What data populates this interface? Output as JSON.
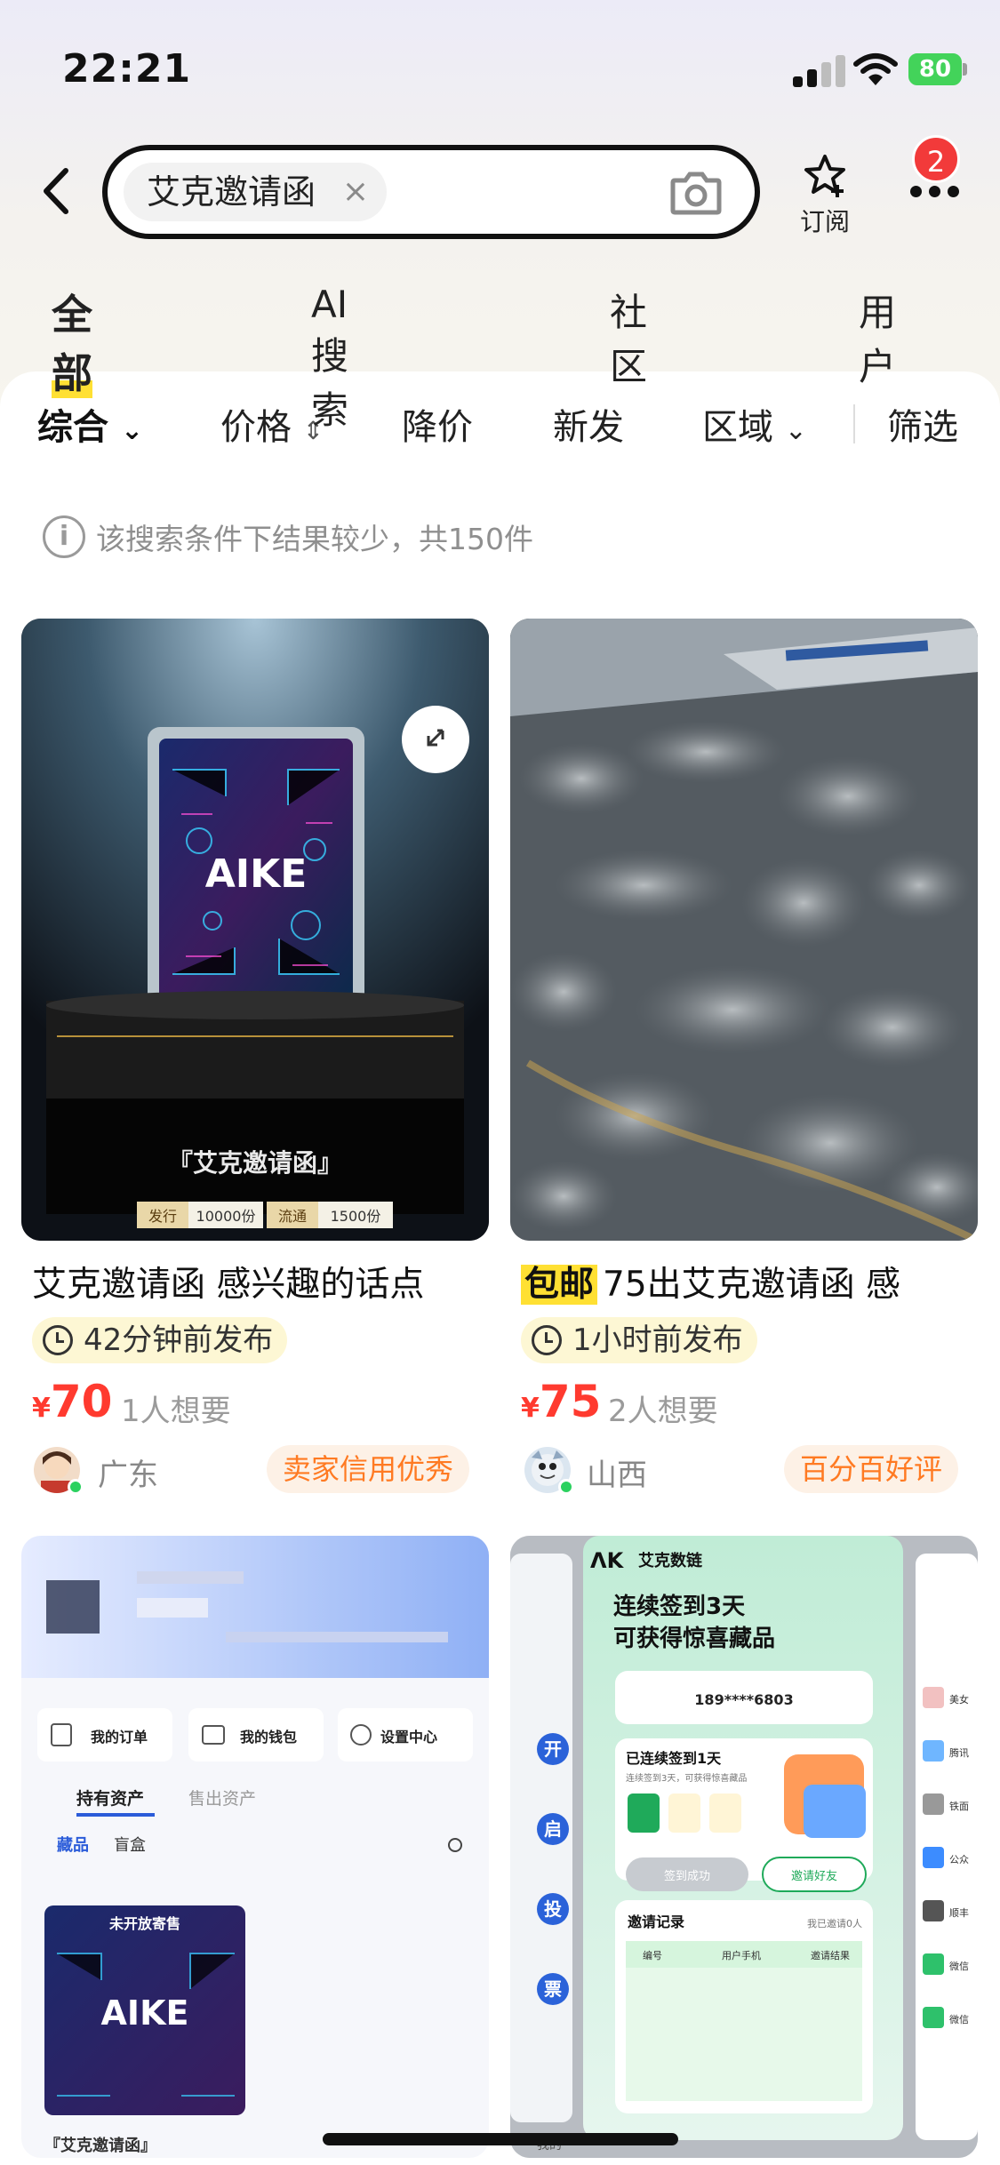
{
  "status_bar": {
    "time": "22:21",
    "battery": "80"
  },
  "search": {
    "query": "艾克邀请函",
    "clear_symbol": "×"
  },
  "header": {
    "subscribe_label": "订阅",
    "notification_count": "2"
  },
  "tabs": [
    {
      "label": "全部",
      "active": true
    },
    {
      "label": "AI 搜索",
      "active": false
    },
    {
      "label": "社区",
      "active": false
    },
    {
      "label": "用户",
      "active": false
    }
  ],
  "filters": {
    "comprehensive": "综合",
    "price": "价格",
    "price_drop": "降价",
    "new": "新发",
    "region": "区域",
    "filter": "筛选"
  },
  "notice": "该搜索条件下结果较少，共150件",
  "products": [
    {
      "image_caption": "『艾克邀请函』",
      "image_logo": "AIKE",
      "image_stat_1_label": "发行",
      "image_stat_1_value": "10000份",
      "image_stat_2_label": "流通",
      "image_stat_2_value": "1500份",
      "title": "艾克邀请函 感兴趣的话点",
      "time": "42分钟前发布",
      "currency": "¥",
      "price": "70",
      "wants": "1人想要",
      "region": "广东",
      "badge": "卖家信用优秀"
    },
    {
      "tag": "包邮",
      "title": "75出艾克邀请函 感",
      "time": "1小时前发布",
      "currency": "¥",
      "price": "75",
      "wants": "2人想要",
      "region": "山西",
      "badge": "百分百好评"
    },
    {
      "screenshot_menu_1": "我的订单",
      "screenshot_menu_2": "我的钱包",
      "screenshot_menu_3": "设置中心",
      "screenshot_tab_1": "持有资产",
      "screenshot_tab_2": "售出资产",
      "screenshot_sub_1": "藏品",
      "screenshot_sub_2": "盲盒",
      "screenshot_card_label": "未开放寄售",
      "screenshot_card_logo": "AIKE",
      "screenshot_card_caption": "『艾克邀请函』"
    },
    {
      "screenshot_brand": "艾克数链",
      "screenshot_headline_1": "连续签到3天",
      "screenshot_headline_2": "可获得惊喜藏品",
      "screenshot_phone": "189****6803",
      "screenshot_streak": "已连续签到1天",
      "screenshot_streak_sub": "连续签到3天，可获得惊喜藏品",
      "screenshot_btn_1": "签到成功",
      "screenshot_btn_2": "邀请好友",
      "screenshot_record": "邀请记录",
      "screenshot_record_count": "我已邀请0人",
      "screenshot_col_1": "编号",
      "screenshot_col_2": "用户手机",
      "screenshot_col_3": "邀请结果",
      "screenshot_side": [
        "开",
        "启",
        "投",
        "票"
      ],
      "screenshot_right": [
        "美女",
        "腾讯",
        "铁面",
        "公众",
        "顺丰",
        "微信",
        "微信"
      ],
      "screenshot_bottom": "我的"
    }
  ],
  "colors": {
    "accent_yellow": "#ffe033",
    "price_red": "#ff3a2f",
    "badge_orange": "#ff7a22"
  }
}
